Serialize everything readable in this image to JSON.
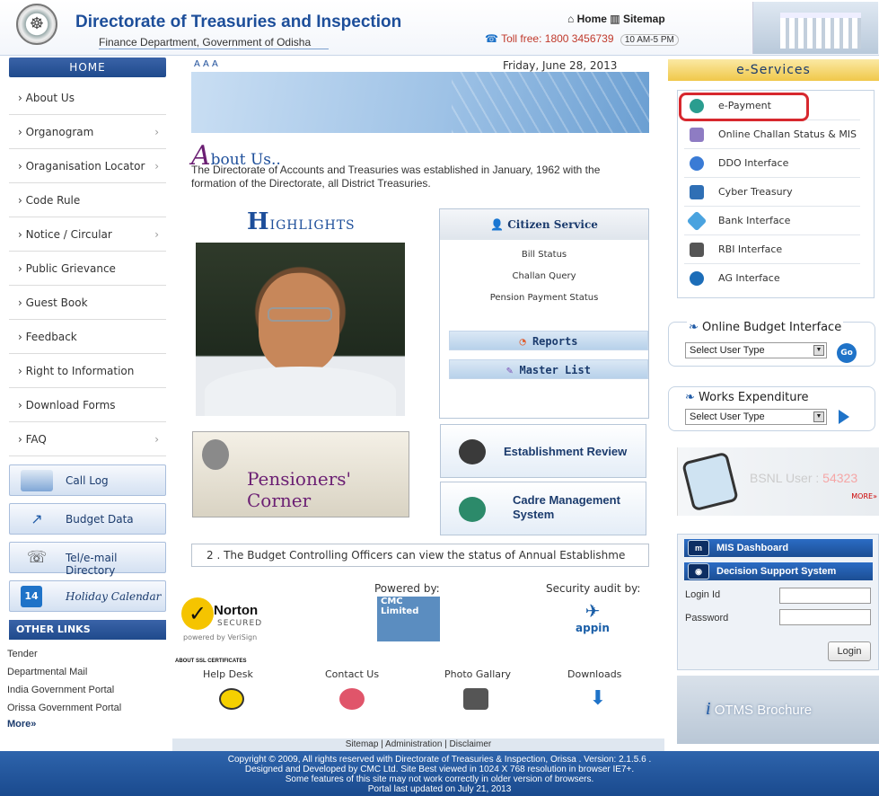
{
  "header": {
    "logo_icon": "odisha-emblem",
    "title": "Directorate of Treasuries and Inspection",
    "subtitle": "Finance Department, Government of Odisha",
    "home_link": "Home",
    "sitemap_link": "Sitemap",
    "toll_free": "Toll free: 1800 3456739",
    "hours": "10 AM-5 PM"
  },
  "left_nav": {
    "home_tab": "HOME",
    "items": [
      {
        "label": "› About Us",
        "submenu": false
      },
      {
        "label": "› Organogram",
        "submenu": true
      },
      {
        "label": "› Oraganisation Locator",
        "submenu": true
      },
      {
        "label": "› Code Rule",
        "submenu": false
      },
      {
        "label": "› Notice / Circular",
        "submenu": true
      },
      {
        "label": "› Public Grievance",
        "submenu": false
      },
      {
        "label": "› Guest Book",
        "submenu": false
      },
      {
        "label": "› Feedback",
        "submenu": false
      },
      {
        "label": "› Right to Information",
        "submenu": false
      },
      {
        "label": "› Download Forms",
        "submenu": false
      },
      {
        "label": "› FAQ",
        "submenu": true
      }
    ],
    "buttons": [
      {
        "label": "Call Log",
        "icon": "call-log-icon"
      },
      {
        "label": "Budget Data",
        "icon": "budget-chart-icon"
      },
      {
        "label": "Tel/e-mail Directory",
        "icon": "telephone-icon"
      },
      {
        "label": "Holiday Calendar",
        "icon": "calendar-icon"
      }
    ],
    "other_links_title": "OTHER LINKS",
    "other_links": [
      "Tender",
      "Departmental Mail",
      "India Government Portal",
      "Orissa Government Portal"
    ],
    "more_link": "More»"
  },
  "main": {
    "font_sizer": "A A A",
    "date": "Friday, June 28, 2013",
    "about_cap": "A",
    "about_rest": "bout Us..",
    "about_text": "The Directorate of Accounts and Treasuries was established in January, 1962 with the formation of the Directorate, all District Treasuries.",
    "highlights_cap": "H",
    "highlights_rest": "IGHLIGHTS",
    "citizen_service_title": "Citizen Service",
    "citizen_links": [
      "Bill Status",
      "Challan Query",
      "Pension Payment Status"
    ],
    "reports_label": "Reports",
    "master_list_label": "Master List",
    "pensioners_corner": "Pensioners' Corner",
    "establishment_review": "Establishment Review",
    "cadre_management": "Cadre Management System",
    "ticker": "2 . The Budget Controlling Officers can view the status of Annual Establishme",
    "norton": {
      "brand": "Norton",
      "secured": "SECURED",
      "powered_by": "powered by VeriSign"
    },
    "powered_by": "Powered by:",
    "cmc": "CMC Limited",
    "security_audit": "Security audit by:",
    "appin": "appin",
    "ssl_certificates": "ABOUT SSL CERTIFICATES",
    "footer_links": [
      "Help Desk",
      "Contact Us",
      "Photo Gallary",
      "Downloads"
    ]
  },
  "right": {
    "eservices_title": "e-Services",
    "eservices": [
      {
        "label": "e-Payment",
        "icon": "epayment-icon",
        "color": "#2a9d8f"
      },
      {
        "label": "Online Challan Status & MIS",
        "icon": "challan-icon",
        "color": "#8e7cc3"
      },
      {
        "label": "DDO Interface",
        "icon": "ddo-icon",
        "color": "#3a7bd5"
      },
      {
        "label": "Cyber Treasury",
        "icon": "cyber-treasury-icon",
        "color": "#2f6fb5"
      },
      {
        "label": "Bank Interface",
        "icon": "bank-icon",
        "color": "#4aa3df"
      },
      {
        "label": "RBI Interface",
        "icon": "rbi-icon",
        "color": "#555555"
      },
      {
        "label": "AG Interface",
        "icon": "ag-icon",
        "color": "#1c6db8"
      }
    ],
    "online_budget_title": "Online Budget Interface",
    "select_user_type": "Select User Type",
    "go_label": "Go",
    "works_expenditure_title": "Works Expenditure",
    "bsnl_label": "BSNL User :",
    "bsnl_count": "54323",
    "bsnl_more": "MORE»",
    "mis_dashboard": "MIS Dashboard",
    "decision_support": "Decision Support System",
    "login_id_label": "Login Id",
    "password_label": "Password",
    "login_button": "Login",
    "otms_i": "i",
    "otms_label": "OTMS Brochure"
  },
  "footer": {
    "sitemap_bar": "Sitemap | Administration | Disclaimer",
    "line1": "Copyright © 2009, All rights reserved with Directorate of Treasuries & Inspection, Orissa . Version: 2.1.5.6 .",
    "line2": "Designed and Developed by CMC Ltd. Site Best viewed in 1024 X 768 resolution in browser IE7+.",
    "line3": "Some features of this site may not work correctly in older version of browsers.",
    "line4": "Portal last updated on July 21, 2013"
  }
}
